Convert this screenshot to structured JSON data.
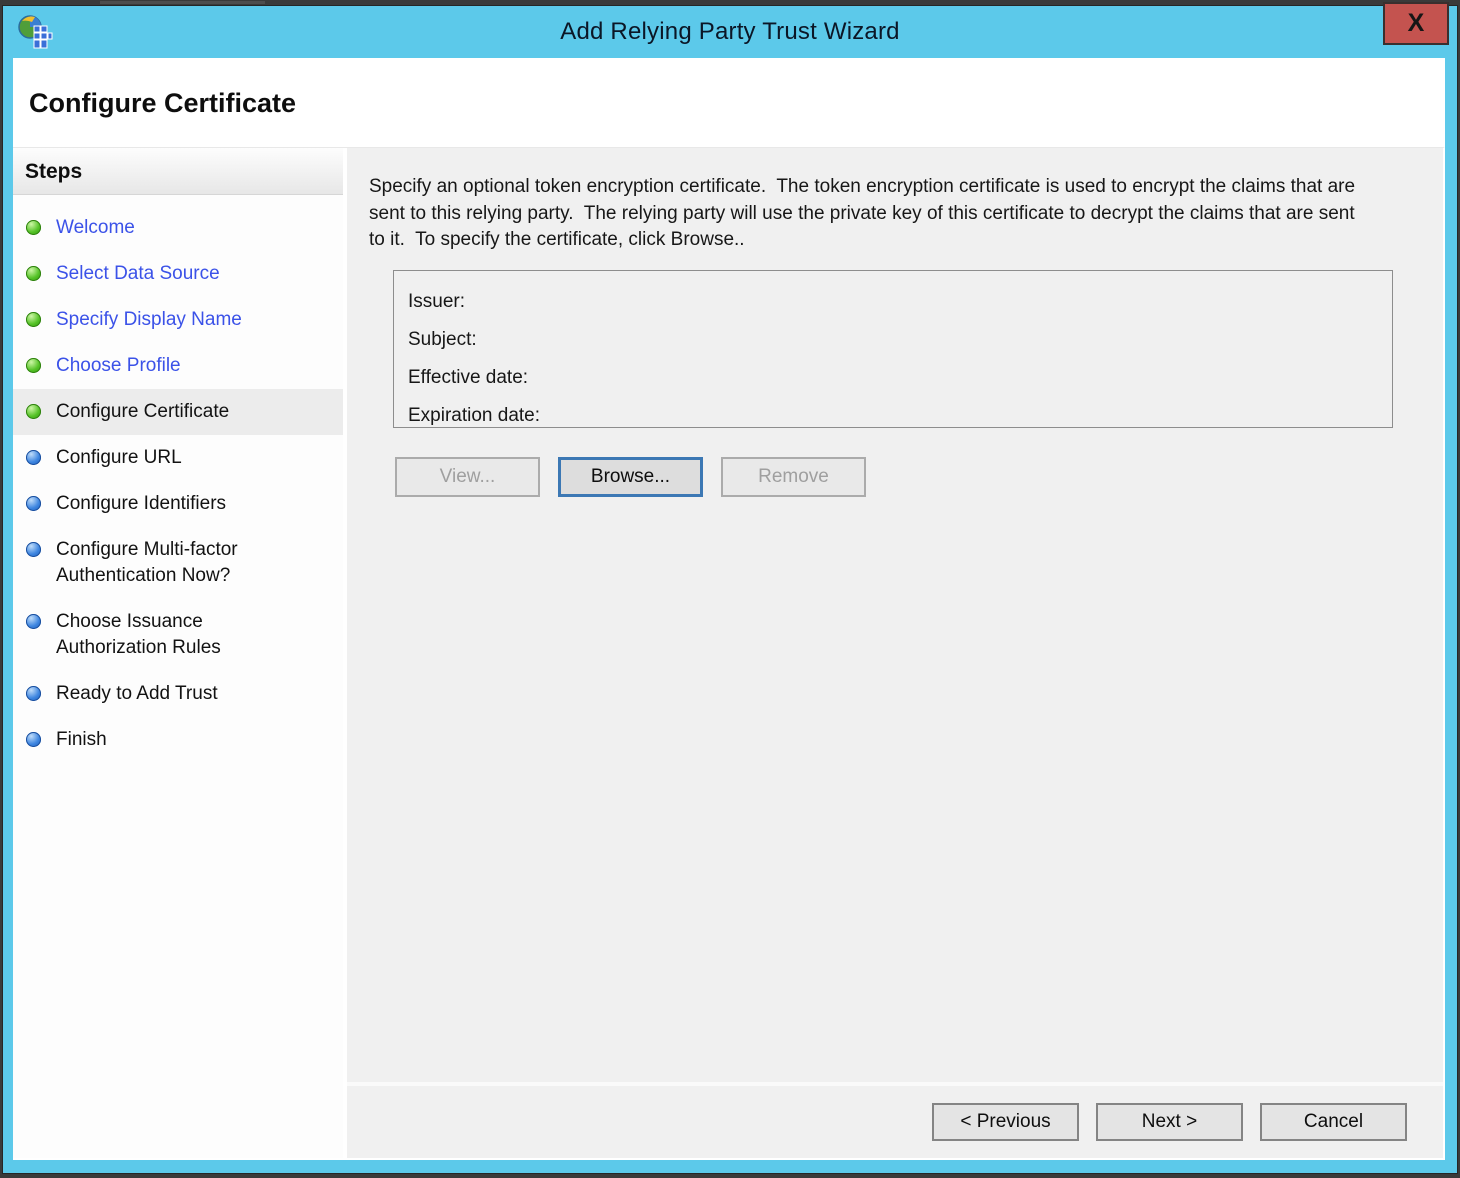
{
  "window": {
    "title": "Add Relying Party Trust Wizard",
    "close_label": "X"
  },
  "page": {
    "heading": "Configure Certificate"
  },
  "steps": {
    "header": "Steps",
    "items": [
      {
        "label": "Welcome",
        "state": "done"
      },
      {
        "label": "Select Data Source",
        "state": "done"
      },
      {
        "label": "Specify Display Name",
        "state": "done"
      },
      {
        "label": "Choose Profile",
        "state": "done"
      },
      {
        "label": "Configure Certificate",
        "state": "current"
      },
      {
        "label": "Configure URL",
        "state": "upcoming"
      },
      {
        "label": "Configure Identifiers",
        "state": "upcoming"
      },
      {
        "label": "Configure Multi-factor Authentication Now?",
        "state": "upcoming"
      },
      {
        "label": "Choose Issuance Authorization Rules",
        "state": "upcoming"
      },
      {
        "label": "Ready to Add Trust",
        "state": "upcoming"
      },
      {
        "label": "Finish",
        "state": "upcoming"
      }
    ]
  },
  "content": {
    "description": "Specify an optional token encryption certificate.  The token encryption certificate is used to encrypt the claims that are sent to this relying party.  The relying party will use the private key of this certificate to decrypt the claims that are sent to it.  To specify the certificate, click Browse..",
    "certificate": {
      "fields": [
        "Issuer:",
        "Subject:",
        "Effective date:",
        "Expiration date:"
      ]
    },
    "buttons": {
      "view": "View...",
      "browse": "Browse...",
      "remove": "Remove"
    }
  },
  "footer": {
    "previous": "< Previous",
    "next": "Next >",
    "cancel": "Cancel"
  },
  "colors": {
    "titlebar": "#5CC9EA",
    "close_button": "#C4534F",
    "link": "#3B52E8",
    "content_bg": "#F0F0F0",
    "bullet_done": "#44B31F",
    "bullet_upcoming": "#2E7BDF"
  }
}
